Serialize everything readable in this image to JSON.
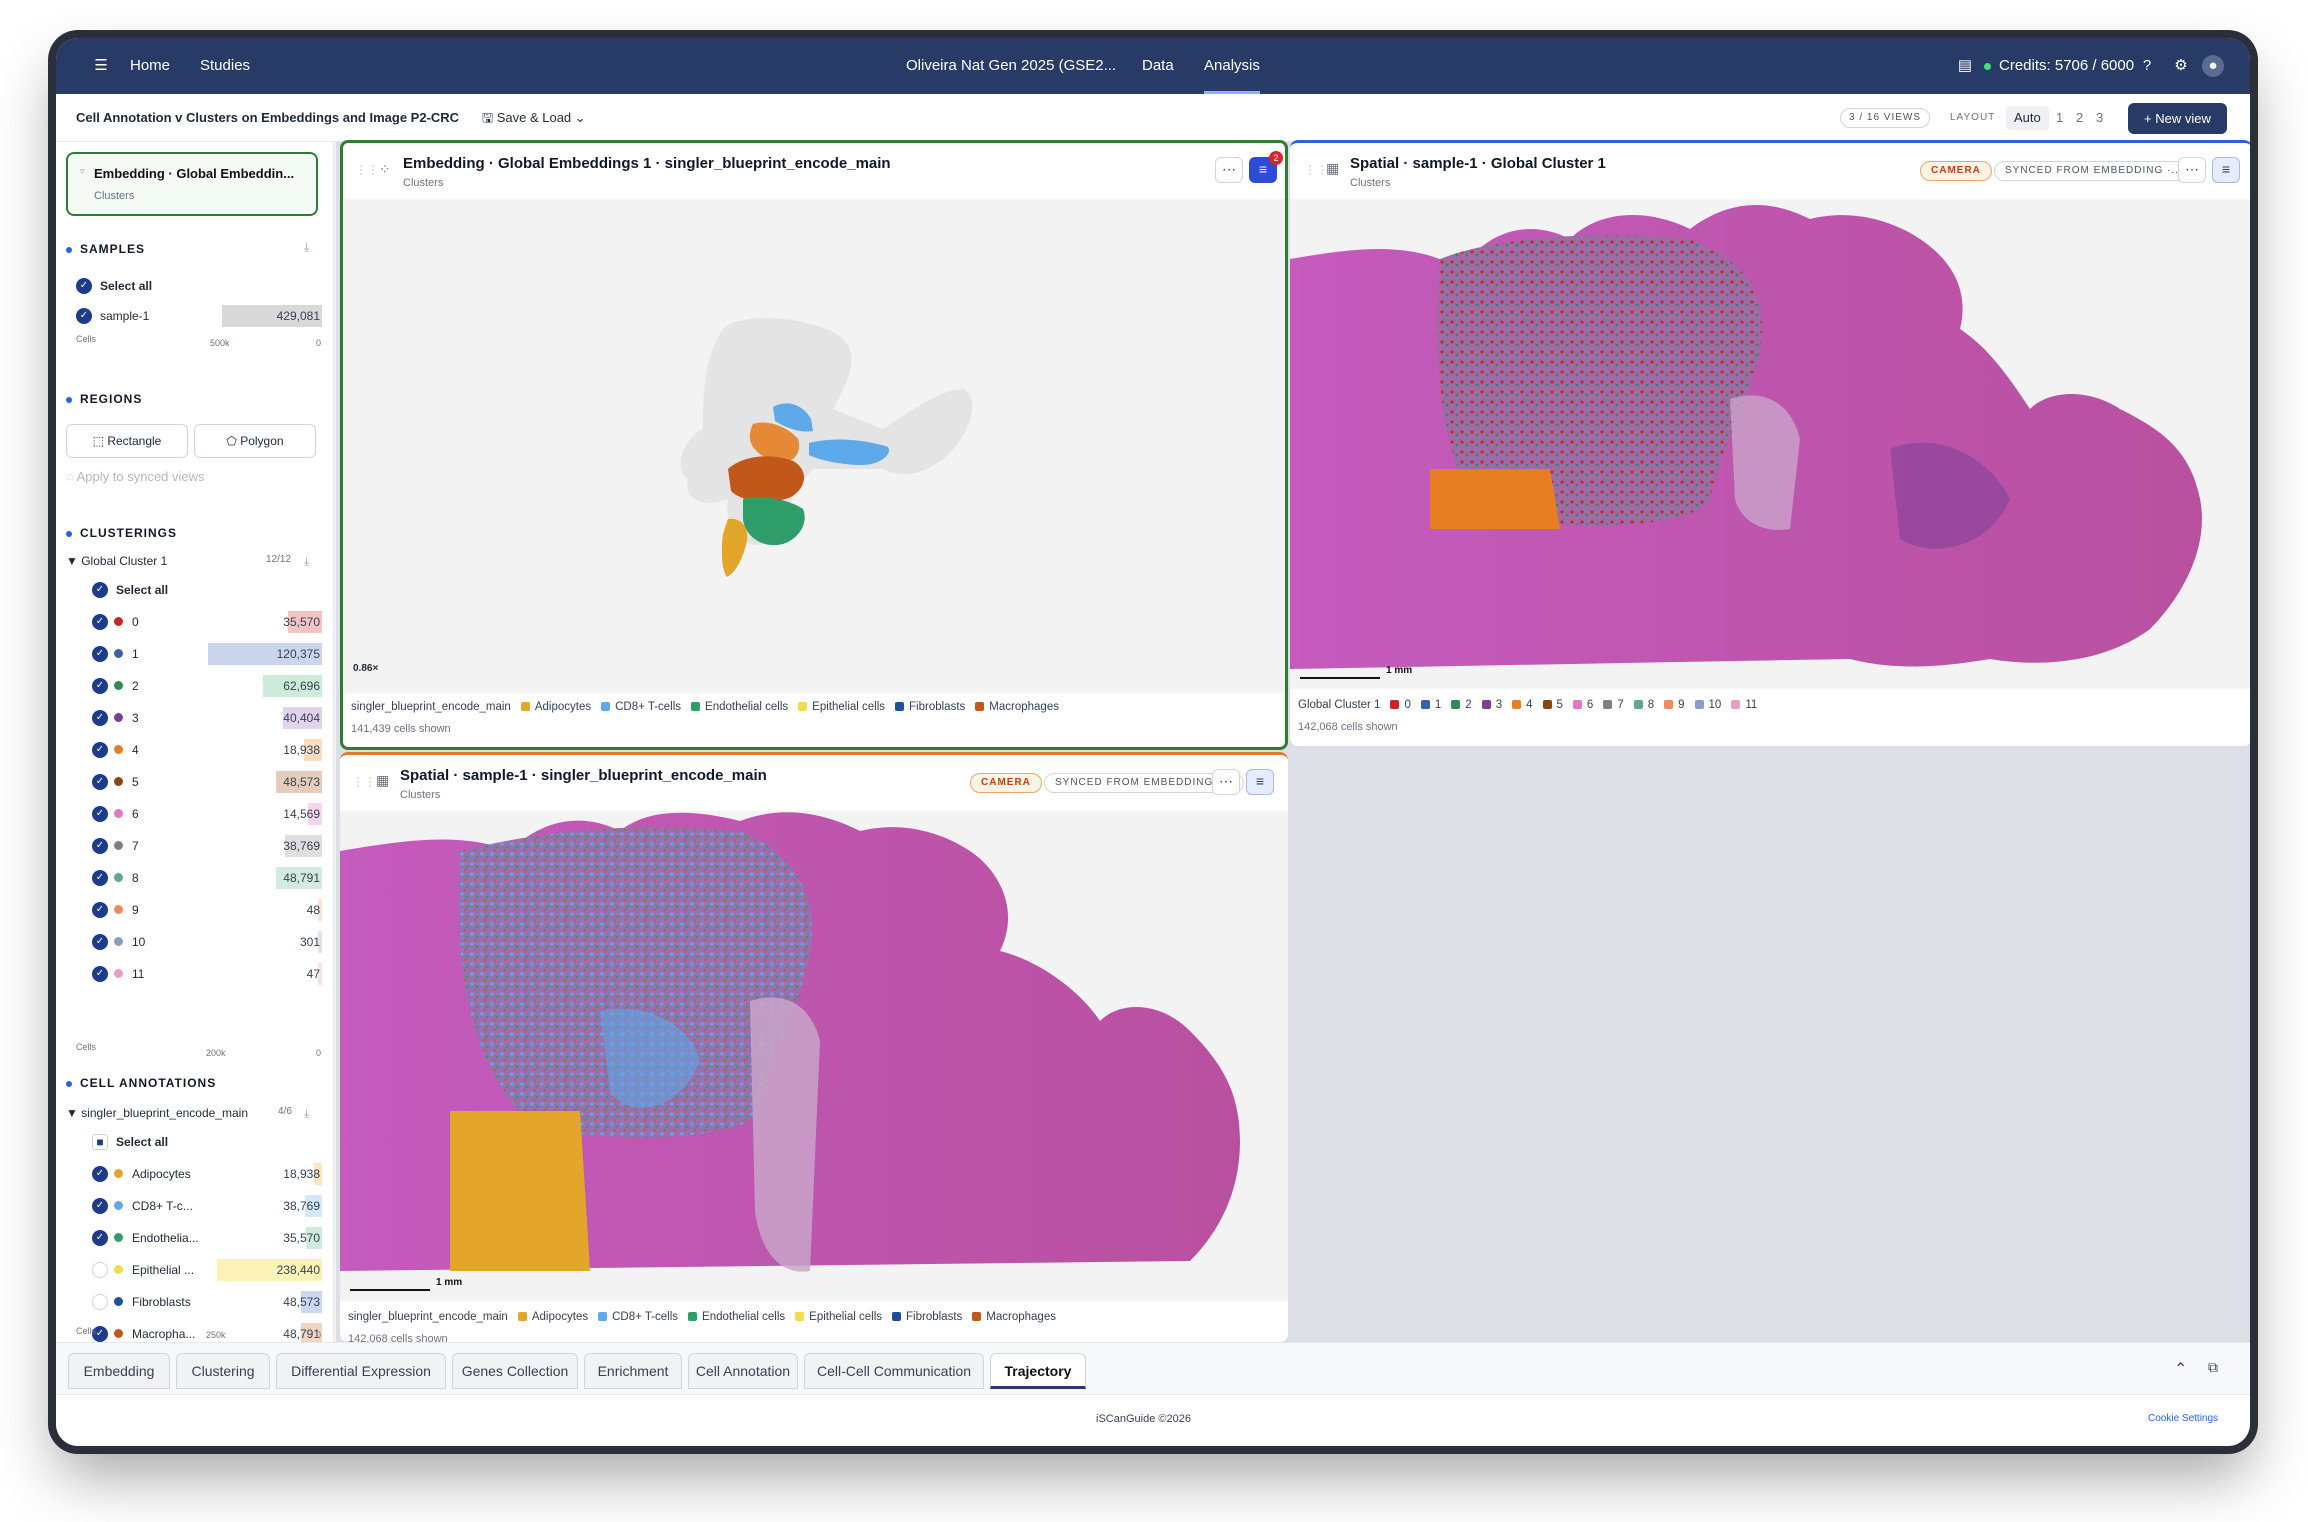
{
  "topbar": {
    "home": "Home",
    "studies": "Studies",
    "study_title": "Oliveira Nat Gen 2025 (GSE2...",
    "data": "Data",
    "analysis": "Analysis",
    "credits": "Credits: 5706 / 6000"
  },
  "subbar": {
    "view_title": "Cell Annotation v Clusters on Embeddings and Image P2-CRC",
    "save_load": "Save & Load",
    "views_count": "3 / 16 VIEWS",
    "layout_label": "LAYOUT",
    "layout_options": [
      "Auto",
      "1",
      "2",
      "3"
    ],
    "new_view": "New view"
  },
  "sidebar": {
    "card_title": "Embedding · Global Embeddin...",
    "card_sub": "Clusters",
    "samples": {
      "title": "SAMPLES",
      "select_all": "Select all",
      "items": [
        {
          "label": "sample-1",
          "value": "429,081"
        }
      ],
      "axis_label": "Cells",
      "axis_max": "500k",
      "axis_min": "0"
    },
    "regions": {
      "title": "REGIONS",
      "rectangle": "Rectangle",
      "polygon": "Polygon",
      "apply": "Apply to synced views"
    },
    "clusterings": {
      "title": "CLUSTERINGS",
      "group": "Global Cluster 1",
      "group_count": "12/12",
      "select_all": "Select all",
      "items": [
        {
          "label": "0",
          "value": "35,570",
          "color": "#c62828",
          "bar": "#f4c4c4",
          "frac": 0.155
        },
        {
          "label": "1",
          "value": "120,375",
          "color": "#3b5fa8",
          "bar": "#c9d6ee",
          "frac": 0.52
        },
        {
          "label": "2",
          "value": "62,696",
          "color": "#2e8b57",
          "bar": "#cdebd9",
          "frac": 0.27
        },
        {
          "label": "3",
          "value": "40,404",
          "color": "#7b3f96",
          "bar": "#e2d3ec",
          "frac": 0.175
        },
        {
          "label": "4",
          "value": "18,938",
          "color": "#e67e22",
          "bar": "#fbdcbf",
          "frac": 0.082
        },
        {
          "label": "5",
          "value": "48,573",
          "color": "#8b4513",
          "bar": "#e6cdbb",
          "frac": 0.21
        },
        {
          "label": "6",
          "value": "14,569",
          "color": "#e377c2",
          "bar": "#f8d4ee",
          "frac": 0.063
        },
        {
          "label": "7",
          "value": "38,769",
          "color": "#7f7f7f",
          "bar": "#dedede",
          "frac": 0.168
        },
        {
          "label": "8",
          "value": "48,791",
          "color": "#5fa98a",
          "bar": "#d2ebdf",
          "frac": 0.211
        },
        {
          "label": "9",
          "value": "48",
          "color": "#f08a5d",
          "bar": "#fde1d4",
          "frac": 0.004
        },
        {
          "label": "10",
          "value": "301",
          "color": "#8c9cc8",
          "bar": "#dde2f0",
          "frac": 0.004
        },
        {
          "label": "11",
          "value": "47",
          "color": "#e6a0c4",
          "bar": "#f7dfec",
          "frac": 0.004
        }
      ],
      "axis_label": "Cells",
      "axis_max": "200k",
      "axis_min": "0"
    },
    "annotations": {
      "title": "CELL ANNOTATIONS",
      "group": "singler_blueprint_encode_main",
      "group_count": "4/6",
      "select_all": "Select all",
      "items": [
        {
          "label": "Adipocytes",
          "value": "18,938",
          "color": "#e3a52a",
          "bar": "#fbe6bf",
          "frac": 0.076,
          "checked": true
        },
        {
          "label": "CD8+ T-c...",
          "value": "38,769",
          "color": "#5da9e9",
          "bar": "#d3e8fa",
          "frac": 0.155,
          "checked": true
        },
        {
          "label": "Endothelia...",
          "value": "35,570",
          "color": "#2e9d6a",
          "bar": "#cdebdc",
          "frac": 0.142,
          "checked": true
        },
        {
          "label": "Epithelial ...",
          "value": "238,440",
          "color": "#f2dc4b",
          "bar": "#fbf3b6",
          "frac": 0.95,
          "checked": false
        },
        {
          "label": "Fibroblasts",
          "value": "48,573",
          "color": "#1f4e9a",
          "bar": "#ccd8ee",
          "frac": 0.194,
          "checked": false
        },
        {
          "label": "Macropha...",
          "value": "48,791",
          "color": "#c2571a",
          "bar": "#f1d4c2",
          "frac": 0.195,
          "checked": true
        }
      ],
      "axis_label": "Cells",
      "axis_max": "250k",
      "axis_min": "0"
    }
  },
  "panels": {
    "embedding": {
      "title": "Embedding · Global Embeddings 1 · singler_blueprint_encode_main",
      "subtitle": "Clusters",
      "filter_count": "2",
      "zoom": "0.86×",
      "legend_title": "singler_blueprint_encode_main",
      "legend": [
        {
          "label": "Adipocytes",
          "color": "#e3a52a"
        },
        {
          "label": "CD8+ T-cells",
          "color": "#5da9e9"
        },
        {
          "label": "Endothelial cells",
          "color": "#2e9d6a"
        },
        {
          "label": "Epithelial cells",
          "color": "#f2dc4b"
        },
        {
          "label": "Fibroblasts",
          "color": "#1f4e9a"
        },
        {
          "label": "Macrophages",
          "color": "#c2571a"
        }
      ],
      "cells_shown": "141,439 cells shown"
    },
    "spatial_cluster": {
      "title": "Spatial · sample-1 · Global Cluster 1",
      "subtitle": "Clusters",
      "camera": "CAMERA",
      "synced": "SYNCED FROM EMBEDDING ·...",
      "scale": "1 mm",
      "legend_title": "Global Cluster 1",
      "legend": [
        {
          "label": "0",
          "color": "#c62828"
        },
        {
          "label": "1",
          "color": "#3b5fa8"
        },
        {
          "label": "2",
          "color": "#2e8b57"
        },
        {
          "label": "3",
          "color": "#7b3f96"
        },
        {
          "label": "4",
          "color": "#e67e22"
        },
        {
          "label": "5",
          "color": "#8b4513"
        },
        {
          "label": "6",
          "color": "#e377c2"
        },
        {
          "label": "7",
          "color": "#7f7f7f"
        },
        {
          "label": "8",
          "color": "#5fa98a"
        },
        {
          "label": "9",
          "color": "#f08a5d"
        },
        {
          "label": "10",
          "color": "#8c9cc8"
        },
        {
          "label": "11",
          "color": "#e6a0c4"
        }
      ],
      "cells_shown": "142,068 cells shown"
    },
    "spatial_annot": {
      "title": "Spatial · sample-1 · singler_blueprint_encode_main",
      "subtitle": "Clusters",
      "camera": "CAMERA",
      "synced": "SYNCED FROM EMBEDDING ·...",
      "scale": "1 mm",
      "legend_title": "singler_blueprint_encode_main",
      "legend": [
        {
          "label": "Adipocytes",
          "color": "#e3a52a"
        },
        {
          "label": "CD8+ T-cells",
          "color": "#5da9e9"
        },
        {
          "label": "Endothelial cells",
          "color": "#2e9d6a"
        },
        {
          "label": "Epithelial cells",
          "color": "#f2dc4b"
        },
        {
          "label": "Fibroblasts",
          "color": "#1f4e9a"
        },
        {
          "label": "Macrophages",
          "color": "#c2571a"
        }
      ],
      "cells_shown": "142,068 cells shown"
    }
  },
  "bottom_tabs": [
    "Embedding",
    "Clustering",
    "Differential Expression",
    "Genes Collection",
    "Enrichment",
    "Cell Annotation",
    "Cell-Cell Communication",
    "Trajectory"
  ],
  "active_tab": "Trajectory",
  "footer": {
    "brand": "iSCanGuide ©2026",
    "cookie": "Cookie Settings"
  }
}
